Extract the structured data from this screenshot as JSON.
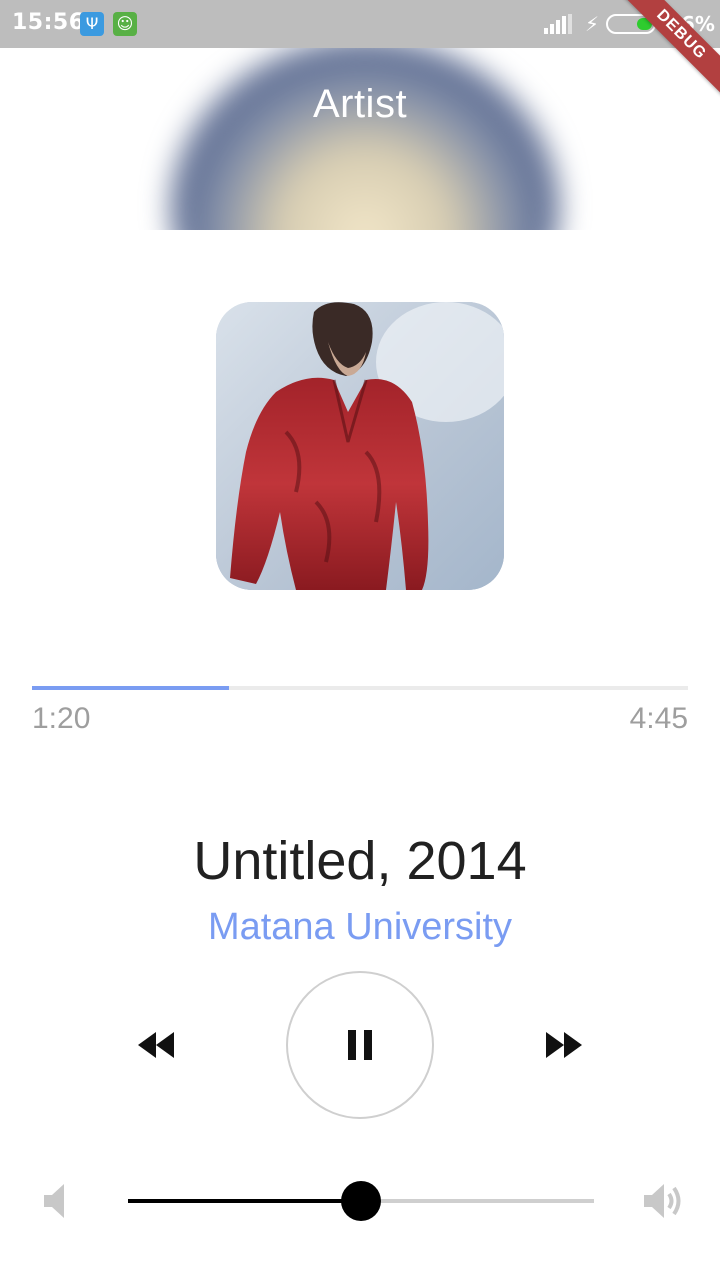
{
  "status_bar": {
    "time": "15:56",
    "battery_percent": "36%",
    "battery_level": 0.36,
    "icons": [
      "usb-icon",
      "android-debug-icon",
      "signal-icon",
      "charging-icon",
      "battery-icon"
    ],
    "debug_banner": "DEBUG"
  },
  "header": {
    "title": "Artist"
  },
  "player": {
    "progress_fraction": 0.3,
    "elapsed": "1:20",
    "total": "4:45",
    "song_title": "Untitled, 2014",
    "artist_name": "Matana University",
    "state": "playing"
  },
  "controls": {
    "rewind_icon": "fast-rewind-icon",
    "pause_icon": "pause-icon",
    "forward_icon": "fast-forward-icon"
  },
  "volume": {
    "level": 0.5,
    "low_icon": "volume-mute-icon",
    "high_icon": "volume-up-icon"
  },
  "colors": {
    "accent": "#7a9cf2",
    "status_bar_bg": "#bdbdbd",
    "debug_banner": "#b24040",
    "title_text": "#212121",
    "secondary_text": "#9e9e9e"
  }
}
